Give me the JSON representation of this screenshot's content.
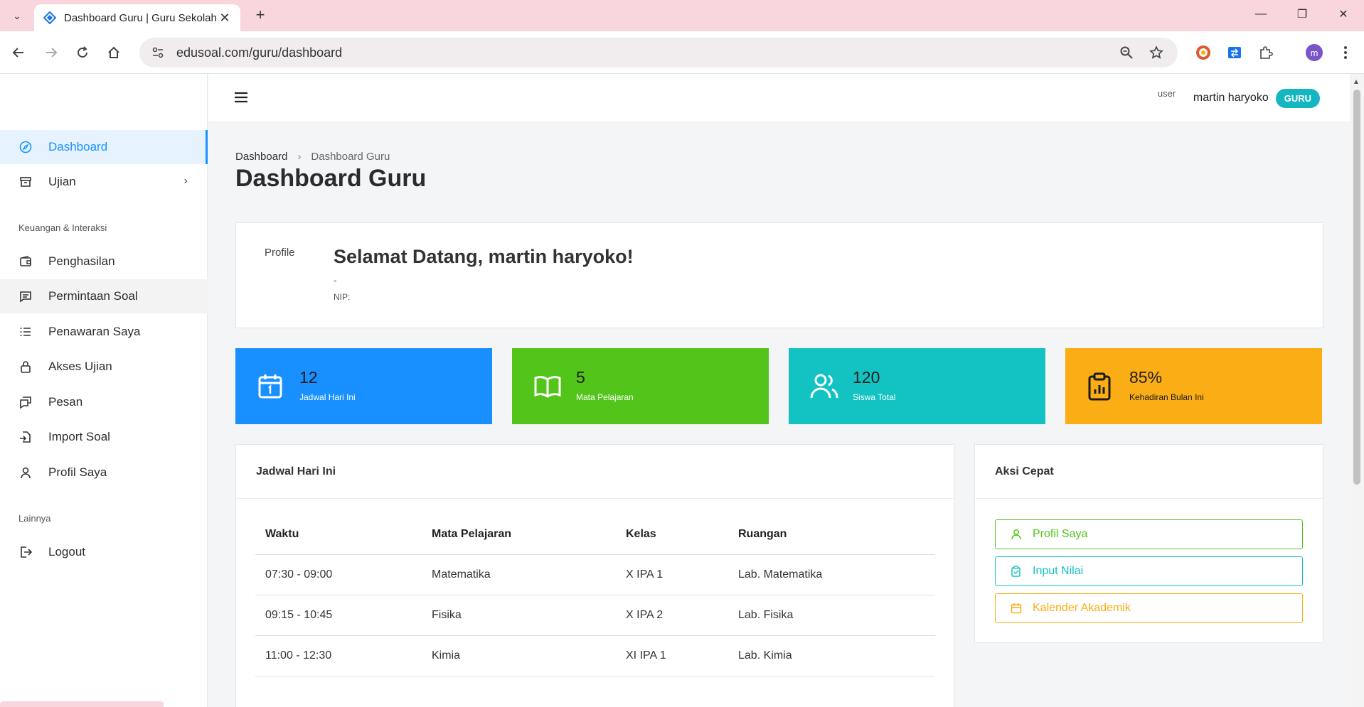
{
  "browser": {
    "tab_title": "Dashboard Guru | Guru Sekolah",
    "url": "edusoal.com/guru/dashboard",
    "profile_initial": "m"
  },
  "sidebar": {
    "items": [
      {
        "label": "Dashboard",
        "icon": "compass-icon"
      },
      {
        "label": "Ujian",
        "icon": "archive-icon"
      },
      {
        "label": "Penghasilan",
        "icon": "wallet-icon"
      },
      {
        "label": "Permintaan Soal",
        "icon": "message-icon"
      },
      {
        "label": "Penawaran Saya",
        "icon": "list-icon"
      },
      {
        "label": "Akses Ujian",
        "icon": "lock-icon"
      },
      {
        "label": "Pesan",
        "icon": "chat-icon"
      },
      {
        "label": "Import Soal",
        "icon": "file-import-icon"
      },
      {
        "label": "Profil Saya",
        "icon": "user-icon"
      },
      {
        "label": "Logout",
        "icon": "logout-icon"
      }
    ],
    "sections": {
      "finance": "Keuangan & Interaksi",
      "other": "Lainnya"
    }
  },
  "header": {
    "user_img_alt": "user",
    "user_name": "martin haryoko",
    "role": "GURU"
  },
  "breadcrumb": {
    "root": "Dashboard",
    "current": "Dashboard Guru"
  },
  "page_title": "Dashboard Guru",
  "welcome": {
    "img_alt": "Profile",
    "title": "Selamat Datang, martin haryoko!",
    "subtitle": "-",
    "nip": "NIP:"
  },
  "stats": [
    {
      "value": "12",
      "label": "Jadwal Hari Ini",
      "color": "#1890ff",
      "icon": "calendar-icon"
    },
    {
      "value": "5",
      "label": "Mata Pelajaran",
      "color": "#52c41a",
      "icon": "book-icon"
    },
    {
      "value": "120",
      "label": "Siswa Total",
      "color": "#13c2c2",
      "icon": "users-icon"
    },
    {
      "value": "85%",
      "label": "Kehadiran Bulan Ini",
      "color": "#faad14",
      "icon": "clipboard-icon"
    }
  ],
  "schedule": {
    "title": "Jadwal Hari Ini",
    "headers": [
      "Waktu",
      "Mata Pelajaran",
      "Kelas",
      "Ruangan"
    ],
    "rows": [
      [
        "07:30 - 09:00",
        "Matematika",
        "X IPA 1",
        "Lab. Matematika"
      ],
      [
        "09:15 - 10:45",
        "Fisika",
        "X IPA 2",
        "Lab. Fisika"
      ],
      [
        "11:00 - 12:30",
        "Kimia",
        "XI IPA 1",
        "Lab. Kimia"
      ]
    ]
  },
  "quick_actions": {
    "title": "Aksi Cepat",
    "buttons": [
      {
        "label": "Profil Saya",
        "color": "#52c41a",
        "icon": "user-icon"
      },
      {
        "label": "Input Nilai",
        "color": "#13c2c2",
        "icon": "clipboard-check-icon"
      },
      {
        "label": "Kalender Akademik",
        "color": "#faad14",
        "icon": "calendar-icon"
      }
    ]
  }
}
